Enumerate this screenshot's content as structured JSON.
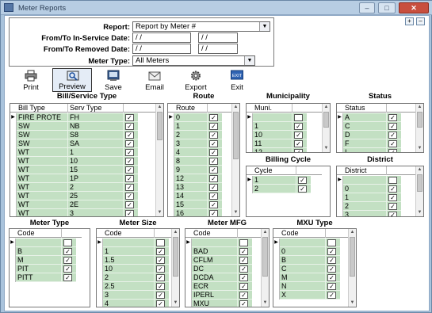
{
  "window": {
    "title": "Meter Reports",
    "min_label": "–",
    "max_label": "□",
    "close_label": "✕"
  },
  "mini_buttons": {
    "expand": "+",
    "collapse": "–"
  },
  "criteria": {
    "report_label": "Report:",
    "report_value": "Report by Meter #",
    "inservice_label": "From/To In-Service Date:",
    "inservice_from": "/ /",
    "inservice_to": "/ /",
    "removed_label": "From/To Removed Date:",
    "removed_from": "/ /",
    "removed_to": "/ /",
    "metertype_label": "Meter Type:",
    "metertype_value": "All Meters"
  },
  "toolbar": [
    {
      "name": "print",
      "label": "Print",
      "icon": "printer-icon"
    },
    {
      "name": "preview",
      "label": "Preview",
      "icon": "preview-icon"
    },
    {
      "name": "save",
      "label": "Save",
      "icon": "save-icon"
    },
    {
      "name": "email",
      "label": "Email",
      "icon": "envelope-icon"
    },
    {
      "name": "export",
      "label": "Export",
      "icon": "gear-icon"
    },
    {
      "name": "exit",
      "label": "Exit",
      "icon": "exit-icon",
      "text": "EXIT"
    }
  ],
  "colors": {
    "row_bg": "#c3e0c3",
    "window_bg": "#a9c3dc"
  },
  "grids": {
    "bill": {
      "title": "Bill/Service Type",
      "columns": [
        "Bill Type",
        "Serv Type"
      ],
      "rows": [
        [
          "FIRE PROTE",
          "FH"
        ],
        [
          "SW",
          "NB"
        ],
        [
          "SW",
          "S8"
        ],
        [
          "SW",
          "SA"
        ],
        [
          "WT",
          "1"
        ],
        [
          "WT",
          "10"
        ],
        [
          "WT",
          "15"
        ],
        [
          "WT",
          "1P"
        ],
        [
          "WT",
          "2"
        ],
        [
          "WT",
          "25"
        ],
        [
          "WT",
          "2E"
        ],
        [
          "WT",
          "3"
        ]
      ]
    },
    "route": {
      "title": "Route",
      "columns": [
        "Route"
      ],
      "rows": [
        [
          "0"
        ],
        [
          "1"
        ],
        [
          "2"
        ],
        [
          "3"
        ],
        [
          "4"
        ],
        [
          "8"
        ],
        [
          "9"
        ],
        [
          "12"
        ],
        [
          "13"
        ],
        [
          "14"
        ],
        [
          "15"
        ],
        [
          "16"
        ]
      ]
    },
    "muni": {
      "title": "Municipality",
      "columns": [
        "Muni."
      ],
      "rows": [
        [
          ""
        ],
        [
          "1"
        ],
        [
          "10"
        ],
        [
          "11"
        ],
        [
          "12"
        ]
      ]
    },
    "status": {
      "title": "Status",
      "columns": [
        "Status"
      ],
      "rows": [
        [
          "A"
        ],
        [
          "C"
        ],
        [
          "D"
        ],
        [
          "F"
        ],
        [
          "I"
        ]
      ]
    },
    "cycle": {
      "title": "Billing Cycle",
      "columns": [
        "Cycle"
      ],
      "rows": [
        [
          "1"
        ],
        [
          "2"
        ]
      ]
    },
    "district": {
      "title": "District",
      "columns": [
        "District"
      ],
      "rows": [
        [
          ""
        ],
        [
          "0"
        ],
        [
          "1"
        ],
        [
          "2"
        ],
        [
          "3"
        ]
      ]
    },
    "metertype": {
      "title": "Meter Type",
      "columns": [
        "Code"
      ],
      "rows": [
        [
          ""
        ],
        [
          "B"
        ],
        [
          "M"
        ],
        [
          "PIT"
        ],
        [
          "PITT"
        ]
      ]
    },
    "metersize": {
      "title": "Meter Size",
      "columns": [
        "Code"
      ],
      "rows": [
        [
          ""
        ],
        [
          "1"
        ],
        [
          "1.5"
        ],
        [
          "10"
        ],
        [
          "2"
        ],
        [
          "2.5"
        ],
        [
          "3"
        ],
        [
          "4"
        ]
      ]
    },
    "metermfg": {
      "title": "Meter MFG",
      "columns": [
        "Code"
      ],
      "rows": [
        [
          ""
        ],
        [
          "BAD"
        ],
        [
          "CFLM"
        ],
        [
          "DC"
        ],
        [
          "DCDA"
        ],
        [
          "ECR"
        ],
        [
          "IPERL"
        ],
        [
          "MXU"
        ]
      ]
    },
    "mxutype": {
      "title": "MXU Type",
      "columns": [
        "Code"
      ],
      "rows": [
        [
          ""
        ],
        [
          "0"
        ],
        [
          "B"
        ],
        [
          "C"
        ],
        [
          "M"
        ],
        [
          "N"
        ],
        [
          "X"
        ]
      ]
    }
  }
}
